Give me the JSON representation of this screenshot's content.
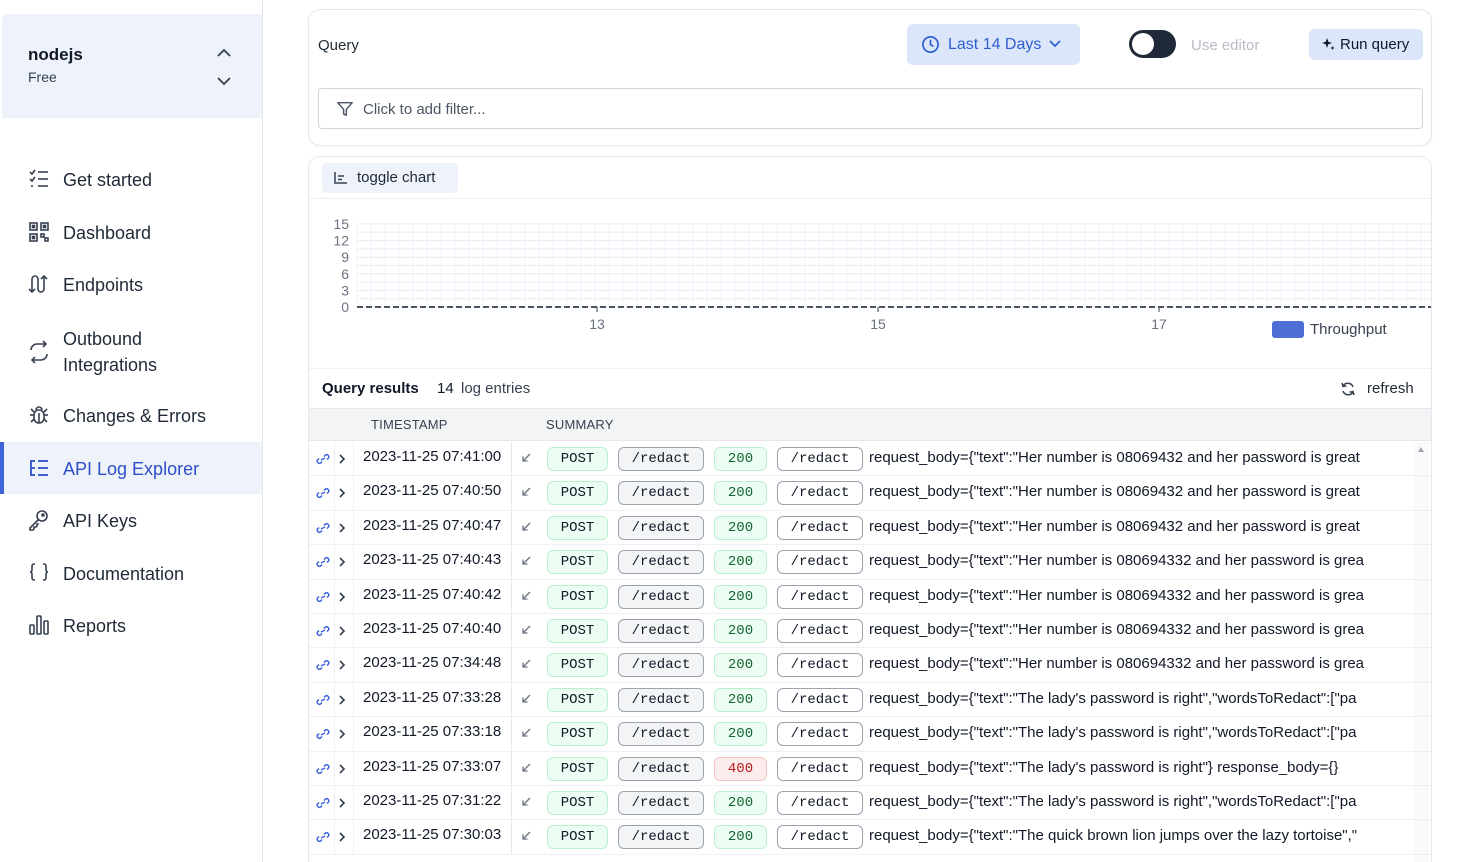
{
  "project": {
    "name": "nodejs",
    "plan": "Free"
  },
  "nav": {
    "items": [
      {
        "label": "Get started",
        "icon": "checklist-icon"
      },
      {
        "label": "Dashboard",
        "icon": "qr-grid-icon"
      },
      {
        "label": "Endpoints",
        "icon": "endpoints-icon"
      },
      {
        "label": "Outbound\nIntegrations",
        "icon": "outbound-icon"
      },
      {
        "label": "Changes & Errors",
        "icon": "bug-icon"
      },
      {
        "label": "API Log Explorer",
        "icon": "list-tree-icon",
        "active": true
      },
      {
        "label": "API Keys",
        "icon": "key-icon"
      },
      {
        "label": "Documentation",
        "icon": "braces-icon"
      },
      {
        "label": "Reports",
        "icon": "bar-chart-icon"
      }
    ]
  },
  "query": {
    "label": "Query",
    "range_label": "Last 14 Days",
    "editor_label": "Use editor",
    "run_label": "Run query",
    "filter_placeholder": "Click to add filter..."
  },
  "chart_toggle_label": "toggle chart",
  "chart_data": {
    "type": "bar",
    "yticks": [
      0,
      3,
      6,
      9,
      12,
      15
    ],
    "xticks": [
      "13",
      "15",
      "17"
    ],
    "ylim": [
      0,
      15
    ],
    "series": [
      {
        "name": "Throughput",
        "color": "#4f6fd6"
      }
    ],
    "legend": "bottom-right",
    "grid": true
  },
  "results": {
    "title": "Query results",
    "count": "14",
    "count_label": "log entries",
    "refresh_label": "refresh",
    "columns": [
      "TIMESTAMP",
      "SUMMARY"
    ],
    "rows": [
      {
        "ts": "2023-11-25 07:41:00",
        "method": "POST",
        "path": "/redact",
        "status": "200",
        "route": "/redact",
        "summary": "request_body={\"text\":\"Her number is 08069432 and her password is great"
      },
      {
        "ts": "2023-11-25 07:40:50",
        "method": "POST",
        "path": "/redact",
        "status": "200",
        "route": "/redact",
        "summary": "request_body={\"text\":\"Her number is 08069432 and her password is great"
      },
      {
        "ts": "2023-11-25 07:40:47",
        "method": "POST",
        "path": "/redact",
        "status": "200",
        "route": "/redact",
        "summary": "request_body={\"text\":\"Her number is 08069432 and her password is great"
      },
      {
        "ts": "2023-11-25 07:40:43",
        "method": "POST",
        "path": "/redact",
        "status": "200",
        "route": "/redact",
        "summary": "request_body={\"text\":\"Her number is 080694332 and her password is grea"
      },
      {
        "ts": "2023-11-25 07:40:42",
        "method": "POST",
        "path": "/redact",
        "status": "200",
        "route": "/redact",
        "summary": "request_body={\"text\":\"Her number is 080694332 and her password is grea"
      },
      {
        "ts": "2023-11-25 07:40:40",
        "method": "POST",
        "path": "/redact",
        "status": "200",
        "route": "/redact",
        "summary": "request_body={\"text\":\"Her number is 080694332 and her password is grea"
      },
      {
        "ts": "2023-11-25 07:34:48",
        "method": "POST",
        "path": "/redact",
        "status": "200",
        "route": "/redact",
        "summary": "request_body={\"text\":\"Her number is 080694332 and her password is grea"
      },
      {
        "ts": "2023-11-25 07:33:28",
        "method": "POST",
        "path": "/redact",
        "status": "200",
        "route": "/redact",
        "summary": "request_body={\"text\":\"The lady's password is right\",\"wordsToRedact\":[\"pa"
      },
      {
        "ts": "2023-11-25 07:33:18",
        "method": "POST",
        "path": "/redact",
        "status": "200",
        "route": "/redact",
        "summary": "request_body={\"text\":\"The lady's password is right\",\"wordsToRedact\":[\"pa"
      },
      {
        "ts": "2023-11-25 07:33:07",
        "method": "POST",
        "path": "/redact",
        "status": "400",
        "route": "/redact",
        "summary": "request_body={\"text\":\"The lady's password is right\"} response_body={}"
      },
      {
        "ts": "2023-11-25 07:31:22",
        "method": "POST",
        "path": "/redact",
        "status": "200",
        "route": "/redact",
        "summary": "request_body={\"text\":\"The lady's password is right\",\"wordsToRedact\":[\"pa"
      },
      {
        "ts": "2023-11-25 07:30:03",
        "method": "POST",
        "path": "/redact",
        "status": "200",
        "route": "/redact",
        "summary": "request_body={\"text\":\"The quick brown lion jumps over the lazy tortoise\",\""
      }
    ]
  }
}
